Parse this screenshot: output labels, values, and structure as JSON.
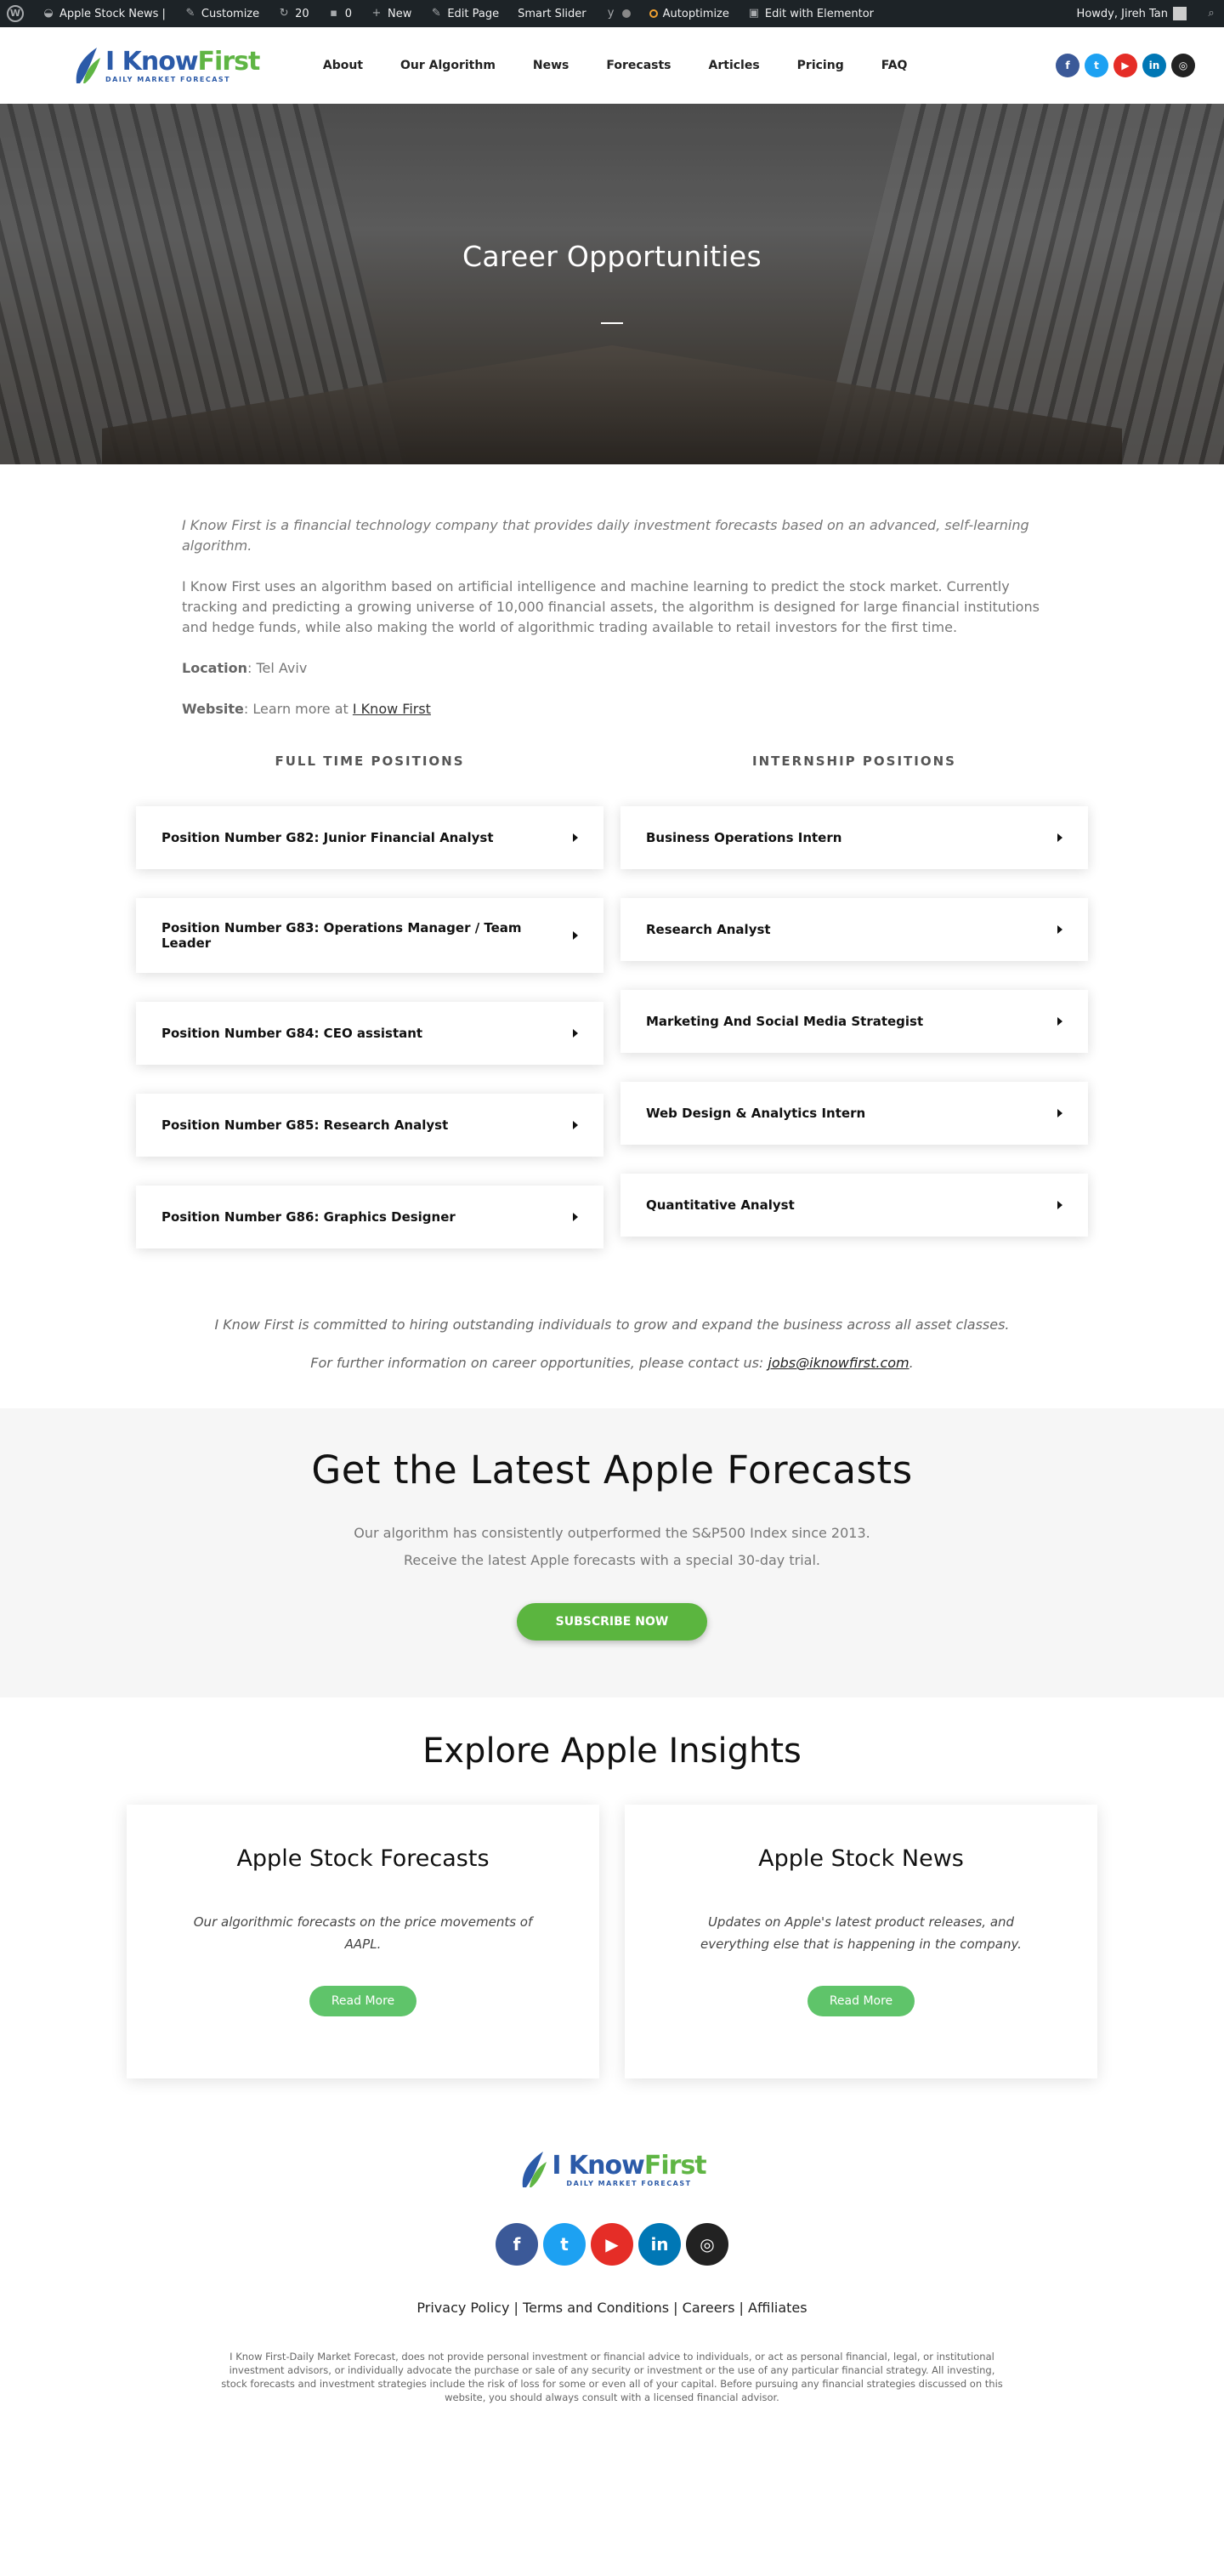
{
  "admin_bar": {
    "site": "Apple Stock News |",
    "customize": "Customize",
    "updates": "20",
    "comments": "0",
    "new": "New",
    "edit_page": "Edit Page",
    "smart_slider": "Smart Slider",
    "autoptimize": "Autoptimize",
    "elementor": "Edit with Elementor",
    "howdy": "Howdy, Jireh Tan"
  },
  "header": {
    "logo_main_i": "I Know",
    "logo_main_f": "First",
    "logo_sub": "DAILY MARKET FORECAST",
    "nav": [
      "About",
      "Our Algorithm",
      "News",
      "Forecasts",
      "Articles",
      "Pricing",
      "FAQ"
    ]
  },
  "hero": {
    "title": "Career Opportunities"
  },
  "intro": {
    "p1": "I Know First is a financial technology company that provides daily investment forecasts based on an advanced, self-learning algorithm.",
    "p2": "I Know First uses an algorithm based on artificial intelligence and machine learning to predict the stock market. Currently tracking and predicting a growing universe of 10,000 financial assets, the algorithm is designed for large financial institutions and hedge funds, while also making the world of algorithmic trading available to retail investors for the first time.",
    "location_label": "Location",
    "location_value": ": Tel Aviv",
    "website_label": "Website",
    "website_text": ": Learn more at ",
    "website_link": "I Know First"
  },
  "positions": {
    "full_time_title": "FULL TIME POSITIONS",
    "internship_title": "INTERNSHIP POSITIONS",
    "full_time": [
      "Position Number G82: Junior Financial Analyst",
      "Position Number G83: Operations Manager / Team Leader",
      "Position Number G84: CEO assistant",
      "Position Number G85: Research Analyst",
      "Position Number G86: Graphics Designer"
    ],
    "internship": [
      "Business Operations Intern",
      "Research Analyst",
      "Marketing And Social Media Strategist",
      "Web Design & Analytics Intern",
      "Quantitative Analyst"
    ]
  },
  "commitment": {
    "line1": "I Know First is committed to hiring outstanding individuals to grow and expand the business across all asset classes.",
    "line2_prefix": "For further information on career opportunities, please contact us: ",
    "email": "jobs@iknowfirst.com",
    "line2_suffix": "."
  },
  "cta": {
    "title": "Get the Latest Apple Forecasts",
    "line1": "Our algorithm has consistently outperformed the S&P500 Index since 2013.",
    "line2": "Receive the latest Apple forecasts with a special 30-day trial.",
    "button": "SUBSCRIBE NOW"
  },
  "explore": {
    "title": "Explore Apple Insights",
    "cards": [
      {
        "title": "Apple Stock Forecasts",
        "text": "Our algorithmic forecasts on the price movements of AAPL.",
        "button": "Read More"
      },
      {
        "title": "Apple Stock News",
        "text": "Updates on Apple's latest product releases, and everything else that is happening in the company.",
        "button": "Read More"
      }
    ]
  },
  "footer": {
    "links": [
      "Privacy Policy",
      "Terms and Conditions",
      "Careers",
      "Affiliates"
    ],
    "separator": " | ",
    "disclaimer": "I Know First-Daily Market Forecast, does not provide personal investment or financial advice to individuals, or act as personal financial, legal, or institutional investment advisors, or individually advocate the purchase or sale of any security or investment or the use of any particular financial strategy. All investing, stock forecasts and investment strategies include the risk of loss for some or even all of your capital. Before pursuing any financial strategies discussed on this website, you should always consult with a licensed financial advisor."
  },
  "social_icons": [
    "facebook-icon",
    "twitter-icon",
    "youtube-icon",
    "linkedin-icon",
    "instagram-icon"
  ],
  "colors": {
    "accent_green": "#5bb53f",
    "brand_blue": "#2b5aa8",
    "admin_bar": "#1d2327"
  }
}
